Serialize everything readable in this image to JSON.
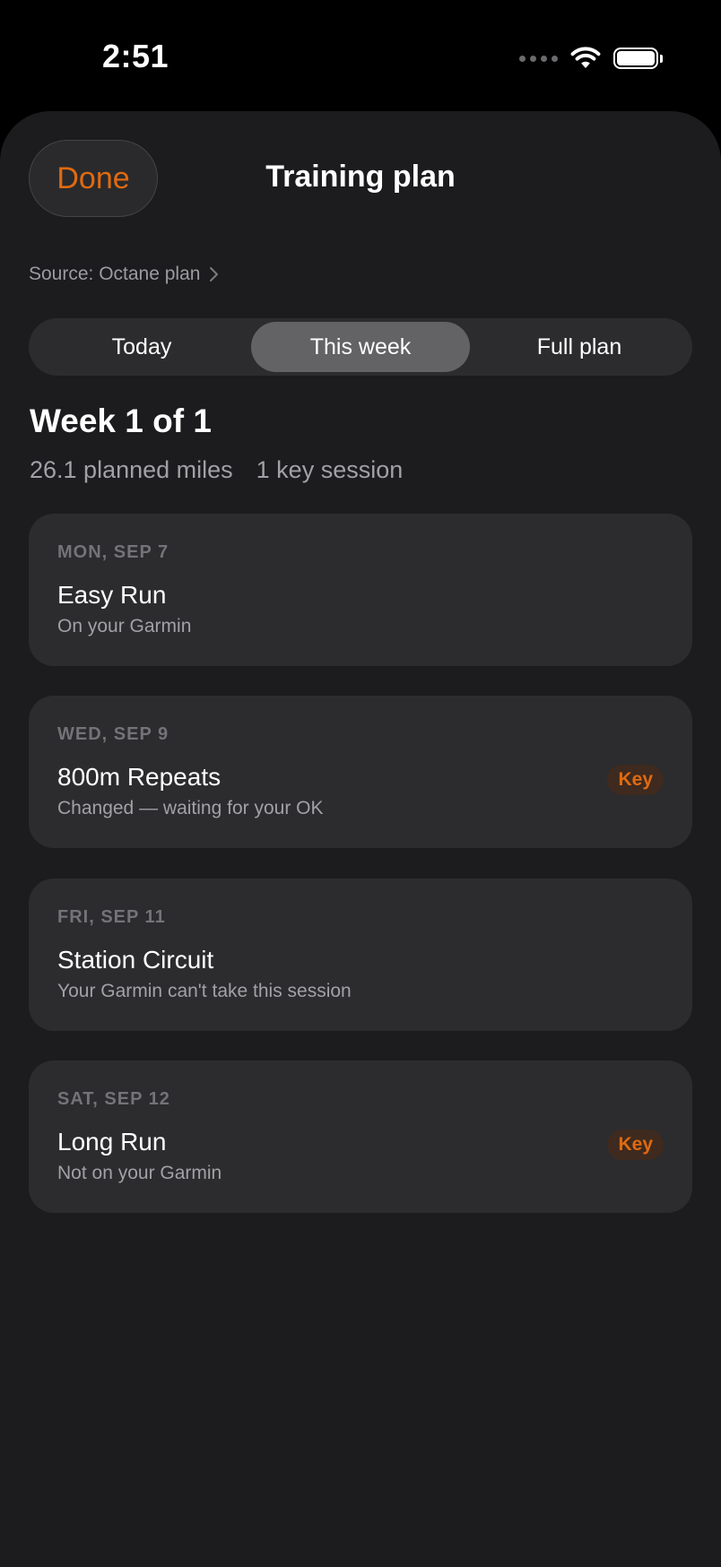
{
  "status_bar": {
    "time": "2:51"
  },
  "header": {
    "done_label": "Done",
    "title": "Training plan"
  },
  "source": {
    "label": "Source: Octane plan"
  },
  "segments": [
    {
      "label": "Today",
      "selected": false
    },
    {
      "label": "This week",
      "selected": true
    },
    {
      "label": "Full plan",
      "selected": false
    }
  ],
  "week": {
    "title": "Week 1 of 1",
    "planned_miles": "26.1 planned miles",
    "key_sessions": "1 key session"
  },
  "sessions": [
    {
      "date": "MON, SEP 7",
      "name": "Easy Run",
      "status": "On your Garmin",
      "badge": ""
    },
    {
      "date": "WED, SEP 9",
      "name": "800m Repeats",
      "status": "Changed — waiting for your OK",
      "badge": "Key"
    },
    {
      "date": "FRI, SEP 11",
      "name": "Station Circuit",
      "status": "Your Garmin can't take this session",
      "badge": ""
    },
    {
      "date": "SAT, SEP 12",
      "name": "Long Run",
      "status": "Not on your Garmin",
      "badge": "Key"
    }
  ],
  "colors": {
    "accent": "#e06a10",
    "background": "#1c1c1e",
    "card": "#2c2c2e",
    "segment_selected": "#636366"
  },
  "icons": {
    "source_chevron": "chevron-right-icon",
    "wifi": "wifi-icon",
    "battery": "battery-icon",
    "signal": "cellular-signal-icon"
  }
}
